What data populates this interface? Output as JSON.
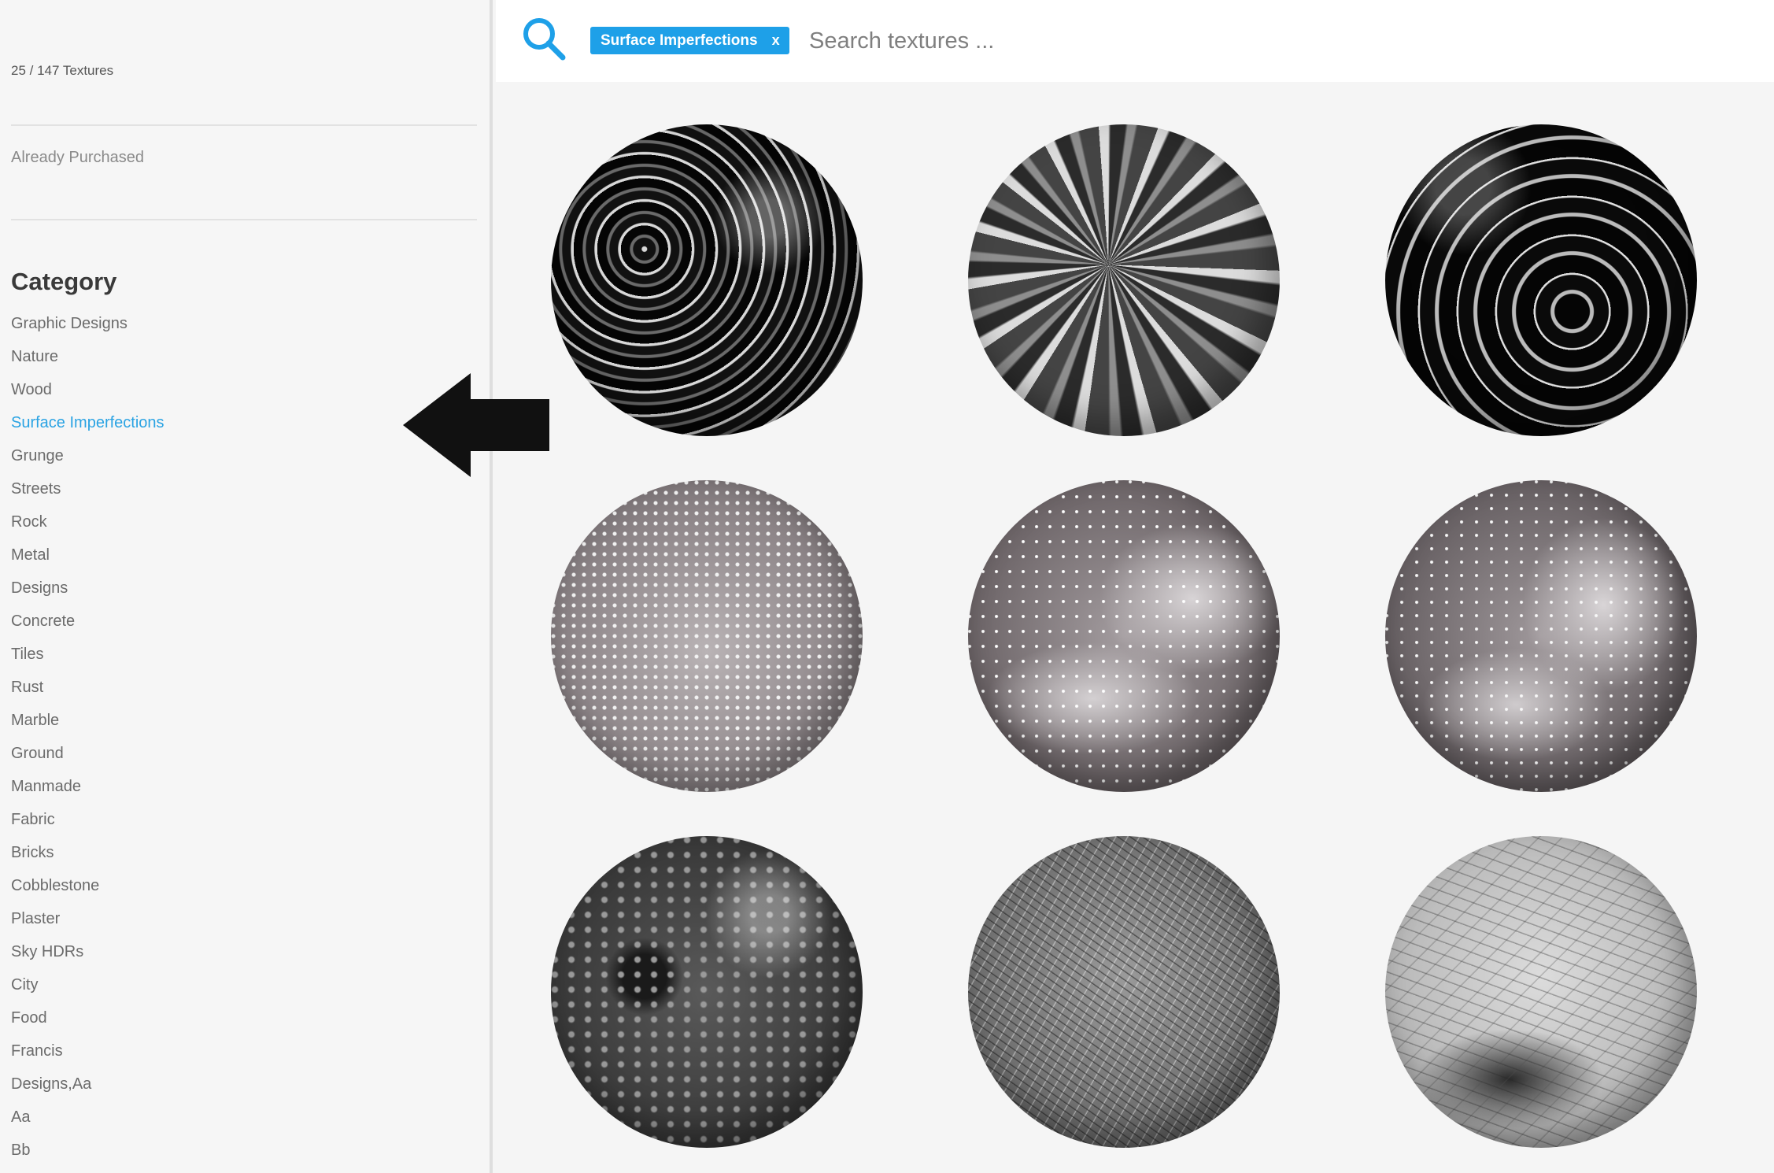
{
  "sidebar": {
    "count_label": "25 / 147 Textures",
    "purchased_label": "Already Purchased",
    "category_title": "Category",
    "categories": [
      {
        "label": "Graphic Designs"
      },
      {
        "label": "Nature"
      },
      {
        "label": "Wood"
      },
      {
        "label": "Surface Imperfections",
        "active": true
      },
      {
        "label": "Grunge"
      },
      {
        "label": "Streets"
      },
      {
        "label": "Rock"
      },
      {
        "label": "Metal"
      },
      {
        "label": "Designs"
      },
      {
        "label": "Concrete"
      },
      {
        "label": "Tiles"
      },
      {
        "label": "Rust"
      },
      {
        "label": "Marble"
      },
      {
        "label": "Ground"
      },
      {
        "label": "Manmade"
      },
      {
        "label": "Fabric"
      },
      {
        "label": "Bricks"
      },
      {
        "label": "Cobblestone"
      },
      {
        "label": "Plaster"
      },
      {
        "label": "Sky HDRs"
      },
      {
        "label": "City"
      },
      {
        "label": "Food"
      },
      {
        "label": "Francis"
      },
      {
        "label": "Designs,Aa"
      },
      {
        "label": "Aa"
      },
      {
        "label": "Bb"
      }
    ]
  },
  "search": {
    "filter_chip": "Surface Imperfections",
    "chip_remove": "x",
    "placeholder": "Search textures ..."
  },
  "colors": {
    "accent": "#1ea0e8",
    "active_link": "#2aa3e3",
    "arrow": "#111111"
  },
  "icons": {
    "search": "magnifier-icon",
    "annotation": "left-arrow-icon"
  },
  "textures": [
    {
      "style": "white-swirl-on-black"
    },
    {
      "style": "grey-streaks"
    },
    {
      "style": "black-with-white-swirls"
    },
    {
      "style": "bumpy-frosted"
    },
    {
      "style": "water-droplets"
    },
    {
      "style": "water-droplets-dense"
    },
    {
      "style": "dark-smudged"
    },
    {
      "style": "scratched-grey"
    },
    {
      "style": "scratched-light"
    }
  ]
}
